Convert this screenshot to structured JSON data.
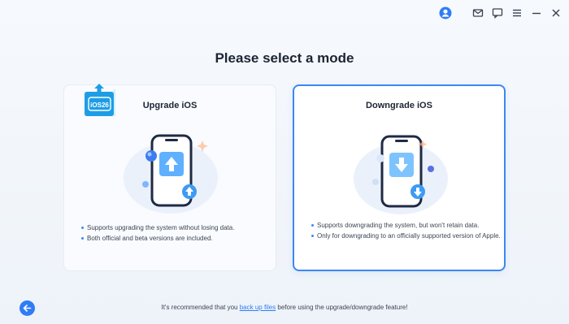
{
  "page": {
    "title": "Please select a mode"
  },
  "titlebar": {
    "icons": [
      "user-avatar-icon",
      "mail-icon",
      "feedback-icon",
      "menu-icon",
      "minimize-icon",
      "close-icon"
    ]
  },
  "cards": [
    {
      "title": "Upgrade iOS",
      "badge_text": "iOS26",
      "bullets": [
        "Supports upgrading the system without losing data.",
        "Both official and beta versions are included."
      ],
      "selected": false
    },
    {
      "title": "Downgrade iOS",
      "bullets": [
        "Supports downgrading the system, but won't retain data.",
        "Only for downgrading to an officially supported version of Apple."
      ],
      "selected": true
    }
  ],
  "footer": {
    "prefix": "It's recommended that you ",
    "link": "back up files",
    "suffix": " before using the upgrade/downgrade feature!"
  },
  "colors": {
    "accent": "#2f7cf6",
    "selected_border": "#3d87f5",
    "background": "#eef3f9"
  }
}
